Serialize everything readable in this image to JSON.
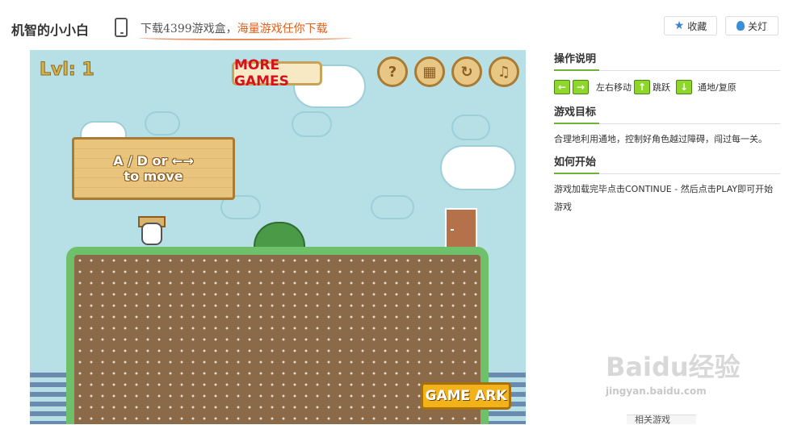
{
  "header": {
    "title": "机智的小小白",
    "promo_part1": "下载4399游戏盒，",
    "promo_part2": "海量游戏任你下载",
    "fav_label": "收藏",
    "light_label": "关灯"
  },
  "game": {
    "level_label": "Lvl: 1",
    "more_games_label": "MORE GAMES",
    "sign_line1": "A / D or ←→",
    "sign_line2": "to move",
    "game_ark_label": "GAME ARK",
    "buttons": [
      {
        "name": "help-button",
        "glyph": "?"
      },
      {
        "name": "level-select-button",
        "glyph": "▦"
      },
      {
        "name": "restart-button",
        "glyph": "↻"
      },
      {
        "name": "music-button",
        "glyph": "♫"
      }
    ]
  },
  "sidebar": {
    "controls_heading": "操作说明",
    "keys": {
      "left": "←",
      "right": "→",
      "up": "↑",
      "down": "↓",
      "move_text": "左右移动",
      "jump_text": "跳跃",
      "portal_text": "通地/复原"
    },
    "goal_heading": "游戏目标",
    "goal_text": "合理地利用通地，控制好角色越过障碍，闯过每一关。",
    "start_heading": "如何开始",
    "start_text": "游戏加载完毕点击CONTINUE - 然后点击PLAY即可开始游戏"
  },
  "footer": {
    "related_label": "相关游戏"
  },
  "watermark": {
    "line1": "Baidu经验",
    "line2": "jingyan.baidu.com"
  }
}
